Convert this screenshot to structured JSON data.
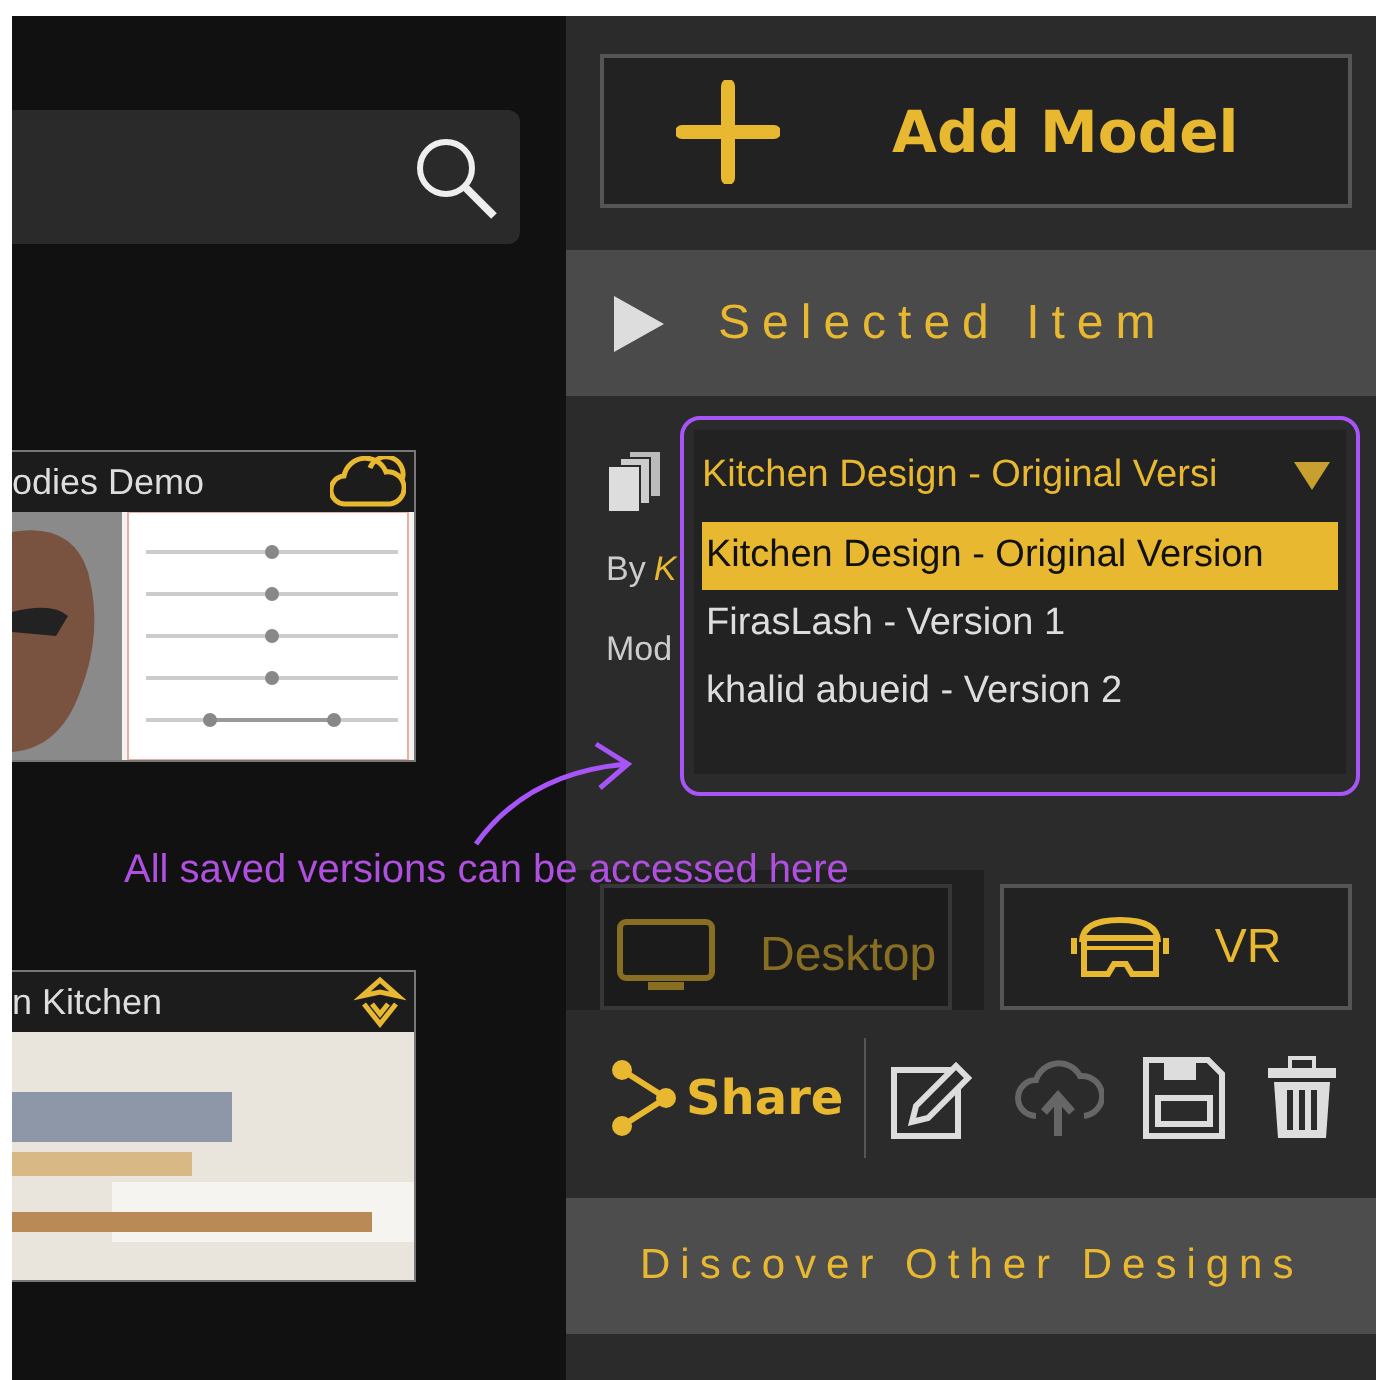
{
  "thumbnails": [
    {
      "title": "odies Demo",
      "kind": "sliders"
    },
    {
      "title": "n Kitchen",
      "kind": "photo"
    }
  ],
  "add_model_button": "Add Model",
  "selected_item": {
    "title": "Selected Item"
  },
  "by_label": "By",
  "author": "K",
  "model_label": "Mod",
  "version_dropdown": {
    "value": "Kitchen Design - Original Versi",
    "options": [
      {
        "label": "Kitchen Design - Original Version",
        "selected": true
      },
      {
        "label": "FirasLash - Version 1",
        "selected": false
      },
      {
        "label": "khalid abueid - Version 2",
        "selected": false
      }
    ]
  },
  "callout": "All saved versions can be accessed here",
  "view_buttons": [
    {
      "label": "Desktop",
      "kind": "desktop"
    },
    {
      "label": "VR",
      "kind": "vr"
    }
  ],
  "share_button": "Share",
  "actions": [
    {
      "kind": "edit",
      "disabled": false
    },
    {
      "kind": "upload",
      "disabled": true
    },
    {
      "kind": "save",
      "disabled": false
    },
    {
      "kind": "delete",
      "disabled": false
    }
  ],
  "discover": "Discover Other Designs"
}
